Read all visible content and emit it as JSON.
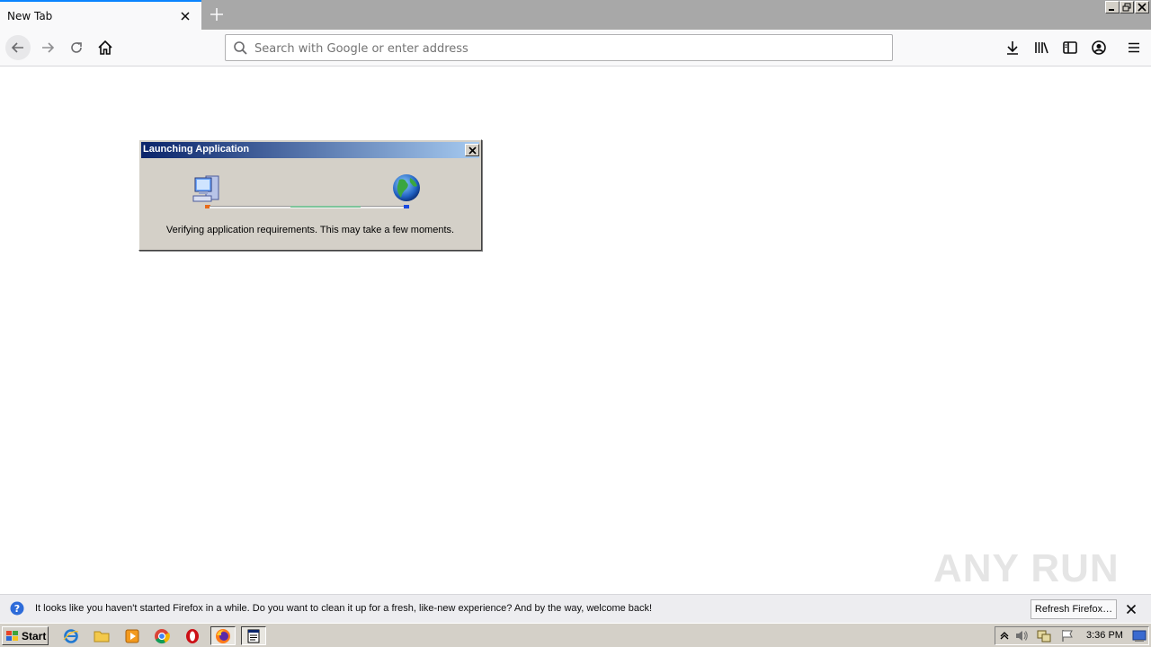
{
  "browser": {
    "tab_title": "New Tab",
    "url_placeholder": "Search with Google or enter address",
    "accent_color": "#0a84ff"
  },
  "dialog": {
    "title": "Launching Application",
    "message": "Verifying application requirements. This may take a few moments.",
    "icons": [
      "computer-icon",
      "globe-icon"
    ]
  },
  "notification": {
    "message": "It looks like you haven't started Firefox in a while. Do you want to clean it up for a fresh, like-new experience? And by the way, welcome back!",
    "button_label": "Refresh Firefox…"
  },
  "watermark": {
    "text": "ANY RUN"
  },
  "taskbar": {
    "start_label": "Start",
    "clock": "3:36 PM",
    "pinned": [
      "ie-icon",
      "folder-icon",
      "media-player-icon",
      "chrome-icon",
      "opera-icon",
      "firefox-icon",
      "app-window-icon"
    ]
  }
}
